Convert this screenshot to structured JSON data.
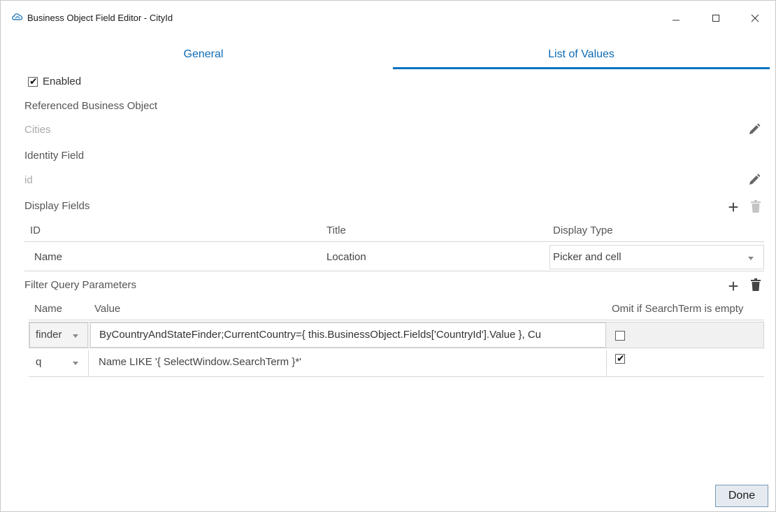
{
  "window": {
    "title": "Business Object Field Editor - CityId",
    "icon": "cloud-icon",
    "controls": {
      "minimize": "minimize-icon",
      "maximize": "maximize-icon",
      "close": "close-icon"
    }
  },
  "tabs": [
    {
      "label": "General",
      "active": false
    },
    {
      "label": "List of Values",
      "active": true
    }
  ],
  "enabled": {
    "label": "Enabled",
    "checked": true
  },
  "referenced_business_object": {
    "label": "Referenced Business Object",
    "value": "Cities"
  },
  "identity_field": {
    "label": "Identity Field",
    "value": "id"
  },
  "display_fields": {
    "label": "Display Fields",
    "columns": [
      "ID",
      "Title",
      "Display Type"
    ],
    "rows": [
      {
        "id": "Name",
        "title": "Location",
        "display_type": "Picker and cell"
      }
    ]
  },
  "filter_query_parameters": {
    "label": "Filter Query Parameters",
    "columns": [
      "Name",
      "Value",
      "Omit if SearchTerm is empty"
    ],
    "rows": [
      {
        "name": "finder",
        "value": "ByCountryAndStateFinder;CurrentCountry={ this.BusinessObject.Fields['CountryId'].Value }, Cu",
        "omit": false
      },
      {
        "name": "q",
        "value": "Name LIKE '{ SelectWindow.SearchTerm }*'",
        "omit": true
      }
    ]
  },
  "done_button": {
    "label": "Done"
  },
  "colors": {
    "accent": "#0a73c3",
    "tab_text": "#0c6bb5"
  }
}
